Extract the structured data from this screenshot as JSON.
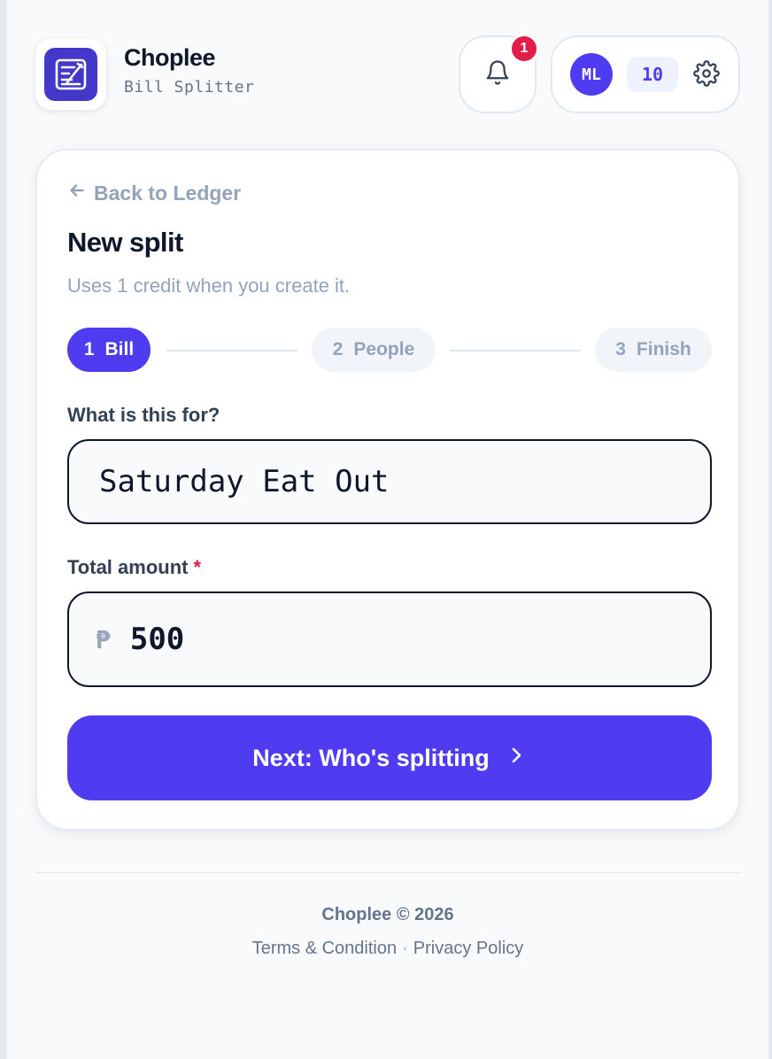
{
  "header": {
    "brand_name": "Choplee",
    "brand_subtitle": "Bill Splitter",
    "notification_count": "1",
    "user_initials": "ML",
    "credits": "10"
  },
  "card": {
    "back_label": "Back to Ledger",
    "title": "New split",
    "subtitle": "Uses 1 credit when you create it.",
    "steps": [
      {
        "number": "1",
        "label": "Bill",
        "active": true
      },
      {
        "number": "2",
        "label": "People",
        "active": false
      },
      {
        "number": "3",
        "label": "Finish",
        "active": false
      }
    ],
    "description_label": "What is this for?",
    "description_value": "Saturday Eat Out",
    "amount_label": "Total amount",
    "amount_required_mark": "*",
    "currency_symbol": "₱",
    "amount_value": "500",
    "next_button_label": "Next: Who's splitting"
  },
  "footer": {
    "copyright": "Choplee © 2026",
    "terms_label": "Terms & Condition",
    "separator": "·",
    "privacy_label": "Privacy Policy"
  },
  "colors": {
    "accent": "#4f3cf0",
    "logo_bg": "#4338ca",
    "badge": "#e11d48",
    "muted_text": "#94a3b8",
    "page_bg": "#f8fafc"
  },
  "icons": {
    "logo": "receipt-logo-icon",
    "notifications": "bell-icon",
    "settings": "gear-icon",
    "back": "arrow-left-icon",
    "next": "chevron-right-icon"
  }
}
